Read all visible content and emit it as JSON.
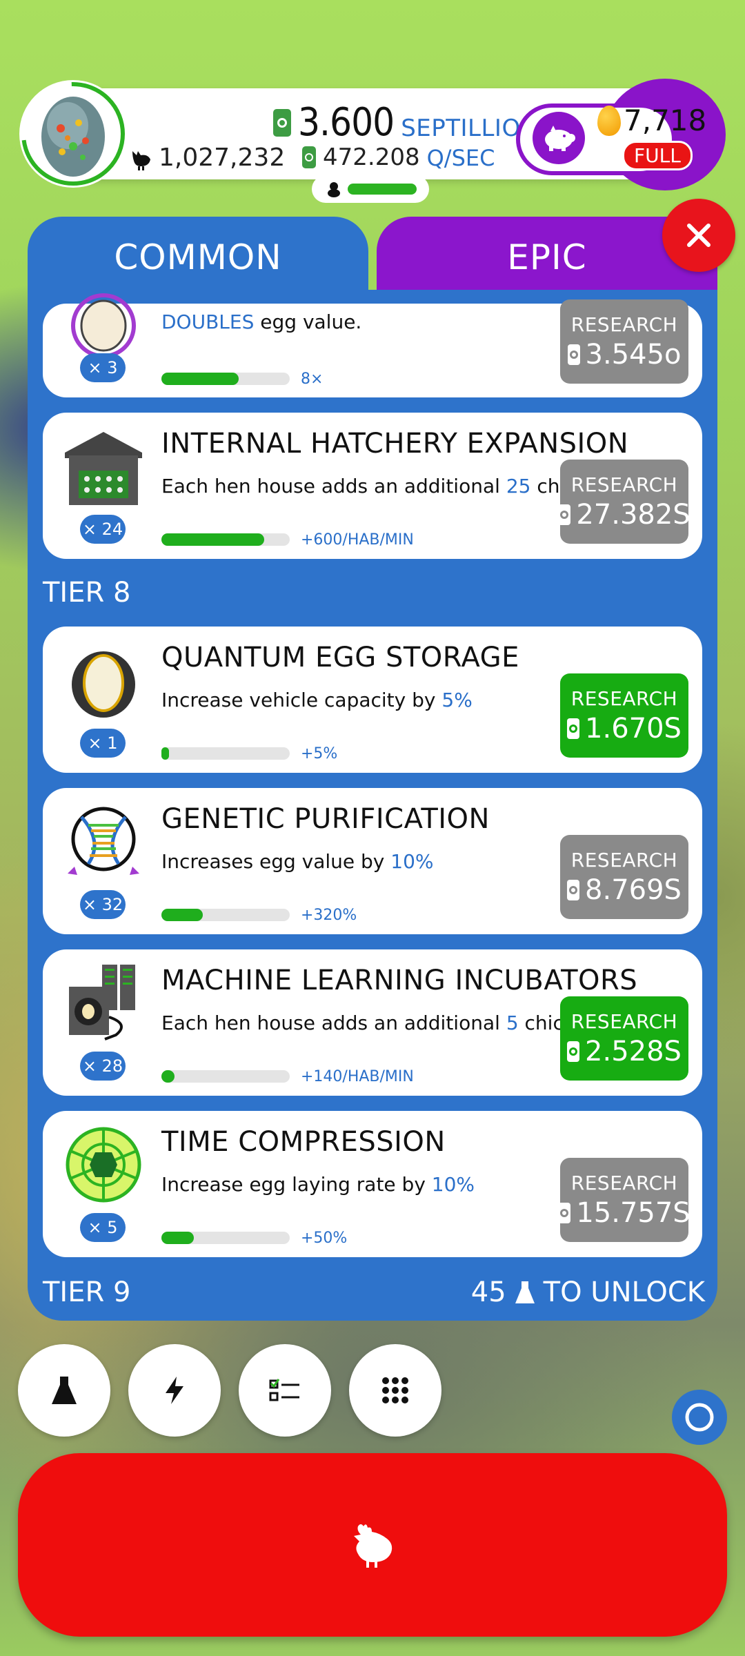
{
  "hud": {
    "chicken_count": "1,027,232",
    "money_value": "3.600",
    "money_unit": "SEPTILLION",
    "rate_value": "472.208",
    "rate_unit": "Q/SEC",
    "golden_eggs": "7,718",
    "piggy_status": "FULL"
  },
  "tabs": [
    {
      "label": "COMMON"
    },
    {
      "label": "EPIC"
    }
  ],
  "cards": [
    {
      "title": "",
      "desc_highlight": "DOUBLES",
      "desc_after": " egg value.",
      "level": "× 3",
      "progress_label": "8×",
      "progress": 0.6,
      "button_label": "RESEARCH",
      "cost": "3.545o",
      "button_state": "grey",
      "icon": "egg-ring-icon"
    },
    {
      "title": "INTERNAL HATCHERY EXPANSION",
      "desc_before": "Each hen house adds an additional ",
      "desc_highlight": "25",
      "desc_after": " chickens/min",
      "level": "× 24",
      "progress_label": "+600/HAB/MIN",
      "progress": 0.8,
      "button_label": "RESEARCH",
      "cost": "27.382S",
      "button_state": "grey",
      "icon": "hen-house-icon"
    },
    {
      "title": "QUANTUM EGG STORAGE",
      "desc_before": "Increase vehicle capacity by ",
      "desc_highlight": "5%",
      "desc_after": "",
      "level": "× 1",
      "progress_label": "+5%",
      "progress": 0.05,
      "button_label": "RESEARCH",
      "cost": "1.670S",
      "button_state": "green",
      "icon": "quantum-egg-icon"
    },
    {
      "title": "GENETIC PURIFICATION",
      "desc_before": "Increases egg value by ",
      "desc_highlight": "10%",
      "desc_after": "",
      "level": "× 32",
      "progress_label": "+320%",
      "progress": 0.32,
      "button_label": "RESEARCH",
      "cost": "8.769S",
      "button_state": "grey",
      "icon": "dna-icon"
    },
    {
      "title": "MACHINE LEARNING INCUBATORS",
      "desc_before": "Each hen house adds an additional ",
      "desc_highlight": "5",
      "desc_after": " chickens/min",
      "level": "× 28",
      "progress_label": "+140/HAB/MIN",
      "progress": 0.1,
      "button_label": "RESEARCH",
      "cost": "2.528S",
      "button_state": "green",
      "icon": "incubator-icon"
    },
    {
      "title": "TIME COMPRESSION",
      "desc_before": "Increase egg laying rate by ",
      "desc_highlight": "10%",
      "desc_after": "",
      "level": "× 5",
      "progress_label": "+50%",
      "progress": 0.25,
      "button_label": "RESEARCH",
      "cost": "15.757S",
      "button_state": "grey",
      "icon": "time-sphere-icon"
    }
  ],
  "tiers": {
    "tier8": "TIER 8",
    "tier9": "TIER 9",
    "unlock_count": "45",
    "unlock_text": "TO UNLOCK"
  },
  "bottom_buttons": [
    {
      "icon": "flask-icon"
    },
    {
      "icon": "lightning-icon"
    },
    {
      "icon": "checklist-icon"
    },
    {
      "icon": "grid-icon"
    }
  ],
  "colors": {
    "panel_blue": "#2e73cb",
    "epic_purple": "#8b16cc",
    "research_green": "#17ac12",
    "research_grey": "#8a8a8a",
    "hatch_red": "#ef0d0d",
    "highlight_blue": "#2a6fc9"
  }
}
